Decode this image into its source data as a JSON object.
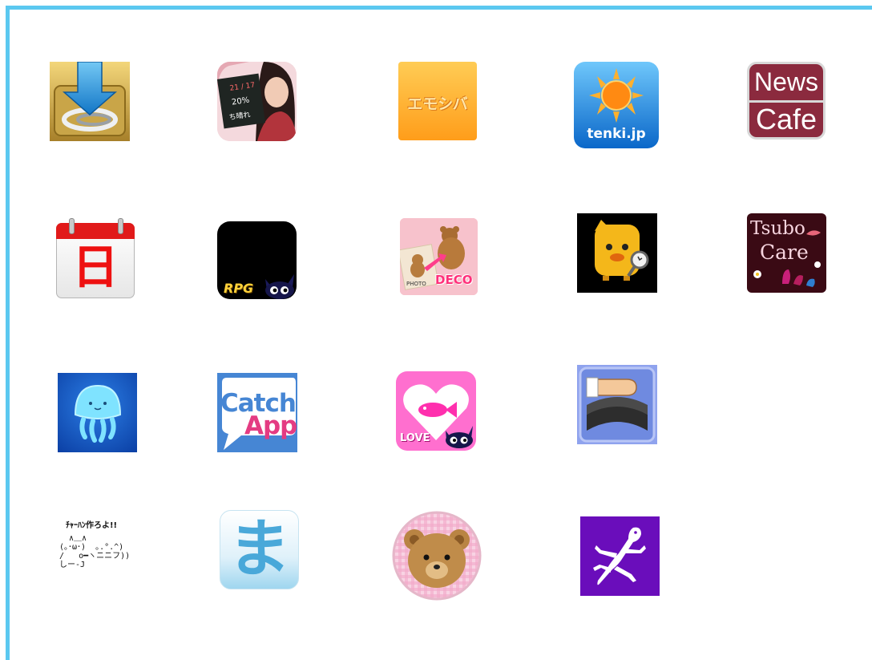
{
  "frame": {
    "accent": "#5bc8f0"
  },
  "icons": [
    {
      "name": "download-clip-icon"
    },
    {
      "name": "weather-girl-icon",
      "date": "21 / 17",
      "pct": "20%",
      "forecast": "ち晴れ"
    },
    {
      "name": "emoshiba-icon",
      "text": "エモシバ"
    },
    {
      "name": "tenki-jp-icon",
      "text": "tenki.jp"
    },
    {
      "name": "news-cafe-icon",
      "line1": "News",
      "line2": "Cafe"
    },
    {
      "name": "calendar-icon",
      "text": "日"
    },
    {
      "name": "rpg-cat-icon",
      "text": "RPG"
    },
    {
      "name": "photo-deco-bear-icon",
      "photo": "PHOTO",
      "deco": "DECO"
    },
    {
      "name": "yellow-character-search-icon"
    },
    {
      "name": "tsubo-care-icon",
      "line1": "Tsubo",
      "line2": "Care"
    },
    {
      "name": "jellyfish-icon"
    },
    {
      "name": "catch-app-icon",
      "line1": "Catch",
      "line2": "App"
    },
    {
      "name": "love-fish-cat-icon",
      "text": "LOVE"
    },
    {
      "name": "hand-tire-icon"
    },
    {
      "name": "ascii-art-icon",
      "title": "ﾁｬｰﾊﾝ作ろよ!!",
      "art": "  ∧＿∧\n(｡･ω･)  ｡.°.^)\n/   o━ヽニニフ))\nしー-J"
    },
    {
      "name": "ma-hiragana-icon",
      "text": "ま"
    },
    {
      "name": "teddy-bear-badge-icon"
    },
    {
      "name": "gecko-icon"
    }
  ]
}
